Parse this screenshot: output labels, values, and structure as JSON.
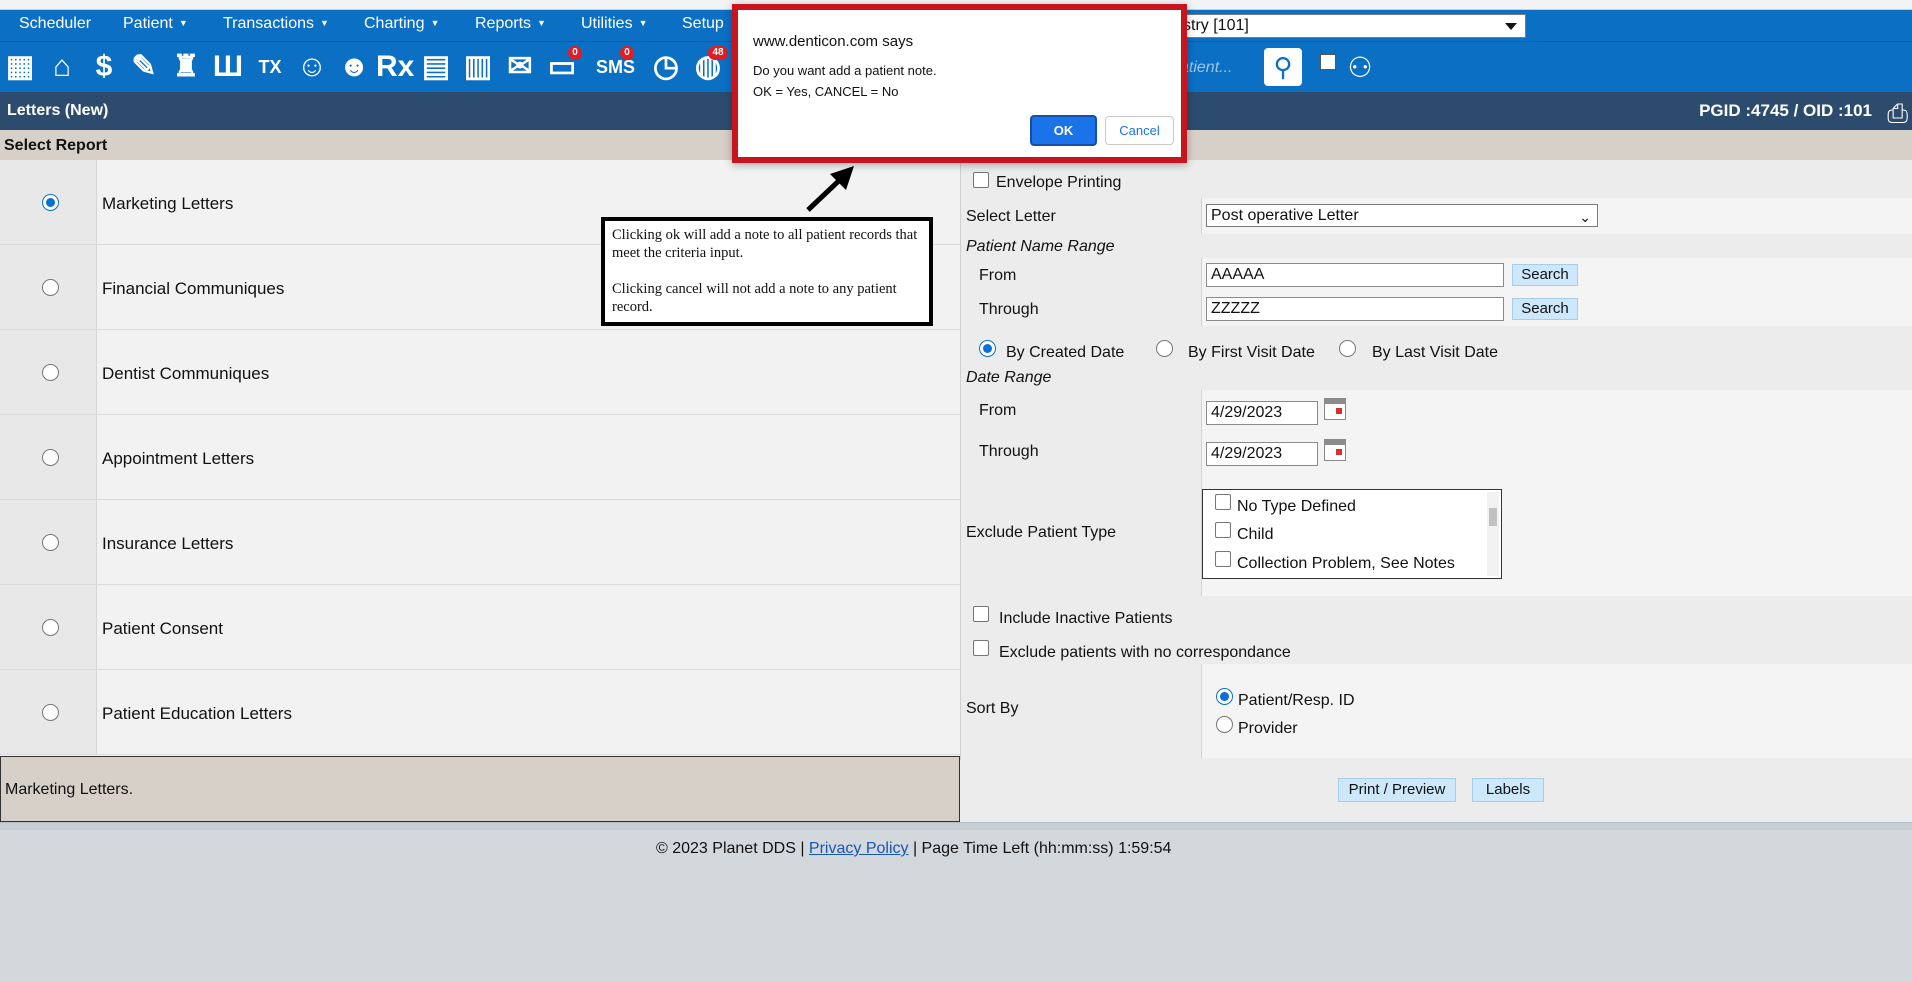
{
  "menu": {
    "items": [
      {
        "label": "Scheduler",
        "caret": false
      },
      {
        "label": "Patient",
        "caret": true
      },
      {
        "label": "Transactions",
        "caret": true
      },
      {
        "label": "Charting",
        "caret": true
      },
      {
        "label": "Reports",
        "caret": true
      },
      {
        "label": "Utilities",
        "caret": true
      },
      {
        "label": "Setup",
        "caret": false
      }
    ],
    "office_select_value": "stry [101]"
  },
  "toolbar": {
    "icons": [
      "calendar-icon",
      "home-icon",
      "dollar-icon",
      "edit-icon",
      "tooth-icon",
      "teeth-icon",
      "tx-calendar-icon",
      "add-patient-icon",
      "add-family-icon",
      "rx-icon",
      "notes-icon",
      "documents-icon",
      "mail-icon",
      "messages-icon",
      "sms-icon",
      "clock-icon",
      "globe-icon"
    ],
    "messages_badge": "0",
    "sms_label": "SMS",
    "sms_badge": "0",
    "rx_label": "Rx",
    "tx_label": "TX",
    "globe_badge": "48",
    "patient_search_placeholder": "atient...",
    "search_icon": "user-search-icon",
    "group_search_icon": "group-search-icon"
  },
  "titlebar": {
    "title": "Letters (New)",
    "ids": "PGID :4745  /  OID :101"
  },
  "section_header": "Select Report",
  "reports": [
    {
      "label": "Marketing Letters",
      "selected": true
    },
    {
      "label": "Financial Communiques",
      "selected": false
    },
    {
      "label": "Dentist Communiques",
      "selected": false
    },
    {
      "label": "Appointment Letters",
      "selected": false
    },
    {
      "label": "Insurance Letters",
      "selected": false
    },
    {
      "label": "Patient Consent",
      "selected": false
    },
    {
      "label": "Patient Education Letters",
      "selected": false
    }
  ],
  "selected_description": "Marketing Letters.",
  "form": {
    "envelope_printing": "Envelope Printing",
    "select_letter_label": "Select Letter",
    "select_letter_value": "Post operative Letter",
    "patient_name_range": "Patient Name Range",
    "from_label": "From",
    "through_label": "Through",
    "name_from": "AAAAA",
    "name_through": "ZZZZZ",
    "search_label": "Search",
    "date_modes": [
      {
        "label": "By Created Date",
        "selected": true
      },
      {
        "label": "By First Visit Date",
        "selected": false
      },
      {
        "label": "By Last Visit Date",
        "selected": false
      }
    ],
    "date_range": "Date Range",
    "date_from": "4/29/2023",
    "date_through": "4/29/2023",
    "exclude_patient_type": "Exclude Patient Type",
    "patient_types": [
      "No Type Defined",
      "Child",
      "Collection Problem, See Notes"
    ],
    "include_inactive": "Include Inactive Patients",
    "exclude_no_corr": "Exclude patients with no correspondance",
    "sort_by": "Sort By",
    "sort_options": [
      {
        "label": "Patient/Resp. ID",
        "selected": true
      },
      {
        "label": "Provider",
        "selected": false
      }
    ],
    "print_preview": "Print / Preview",
    "labels": "Labels"
  },
  "footer": {
    "copyright": "© 2023 Planet DDS |",
    "privacy": "Privacy Policy",
    "time_left": "|  Page Time Left (hh:mm:ss) 1:59:54"
  },
  "annotation": {
    "line1": "Clicking ok will add a note to all patient records that meet the criteria input.",
    "line2": "Clicking cancel will not add a note to any patient record."
  },
  "dialog": {
    "origin": "www.denticon.com says",
    "message": "Do you want add a patient note.",
    "hint": "OK = Yes, CANCEL = No",
    "ok": "OK",
    "cancel": "Cancel"
  },
  "colors": {
    "menu_blue": "#0b6fc4",
    "title_navy": "#2d4c6d",
    "dialog_border": "#c8141c",
    "ok_blue": "#1a73e8"
  }
}
